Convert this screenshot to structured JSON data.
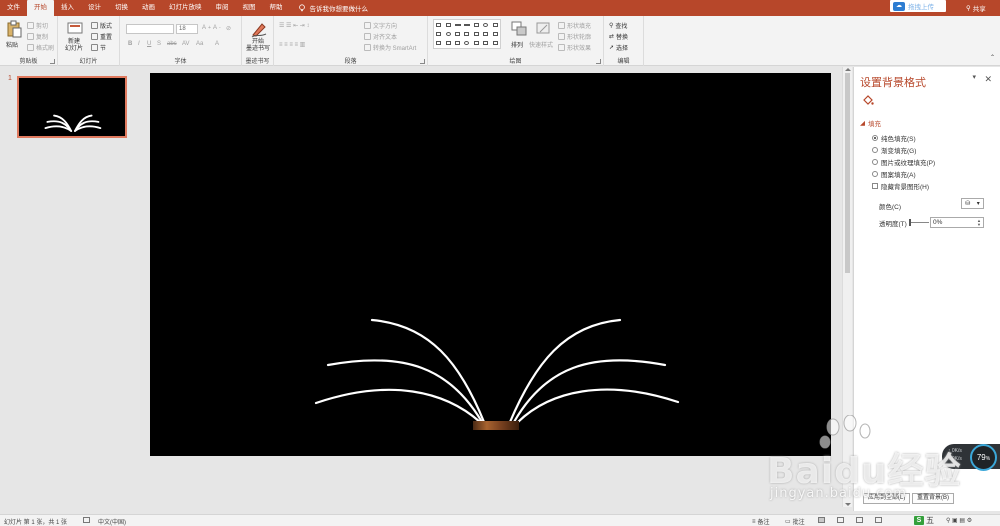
{
  "tabs": [
    "文件",
    "开始",
    "插入",
    "设计",
    "切换",
    "动画",
    "幻灯片放映",
    "审阅",
    "视图",
    "帮助"
  ],
  "active_tab_index": 1,
  "tell_me": "告诉我你想要做什么",
  "upload_label": "拖拽上传",
  "share_label": "共享",
  "ribbon": {
    "clipboard": {
      "paste": "粘贴",
      "cut": "剪切",
      "copy": "复制",
      "format_painter": "格式刷",
      "label": "剪贴板"
    },
    "slides": {
      "new_slide": "新建",
      "new_slide2": "幻灯片",
      "layout": "版式",
      "reset": "重置",
      "section": "节",
      "label": "幻灯片"
    },
    "font": {
      "font_size": "18",
      "label": "字体"
    },
    "ink": {
      "start": "开始",
      "ink_writing": "墨迹书写",
      "label": "墨迹书写"
    },
    "paragraph": {
      "text_direction": "文字方向",
      "align_text": "对齐文本",
      "smartart": "转换为 SmartArt",
      "label": "段落"
    },
    "drawing": {
      "arrange": "排列",
      "quick_styles": "快速样式",
      "shape_fill": "形状填充",
      "shape_outline": "形状轮廓",
      "shape_effects": "形状效果",
      "label": "绘图"
    },
    "editing": {
      "find": "查找",
      "replace": "替换",
      "select": "选择",
      "label": "编辑"
    }
  },
  "thumbnail": {
    "number": "1"
  },
  "format_pane": {
    "title": "设置背景格式",
    "section": "填充",
    "options": [
      {
        "label": "纯色填充(S)",
        "selected": true
      },
      {
        "label": "渐变填充(G)",
        "selected": false
      },
      {
        "label": "图片或纹理填充(P)",
        "selected": false
      },
      {
        "label": "图案填充(A)",
        "selected": false
      }
    ],
    "hide_bg": "隐藏背景图形(H)",
    "color_label": "颜色(C)",
    "transparency_label": "透明度(T)",
    "transparency_value": "0%",
    "apply_all": "应用到全部(L)",
    "reset_bg": "重置背景(B)"
  },
  "status": {
    "slide_info": "幻灯片 第 1 张，共 1 张",
    "language": "中文(中国)",
    "notes": "备注",
    "comments": "批注"
  },
  "ime": {
    "label": "五"
  },
  "watermark": {
    "text": "Baidu经验",
    "url": "jingyan.baidu.com"
  },
  "speed_widget": {
    "value": "79",
    "unit": "%",
    "up": "0K/s",
    "down": "0K/s"
  },
  "colors": {
    "accent": "#b7472a",
    "slide_bg": "#000000",
    "lines": "#ffffff"
  }
}
